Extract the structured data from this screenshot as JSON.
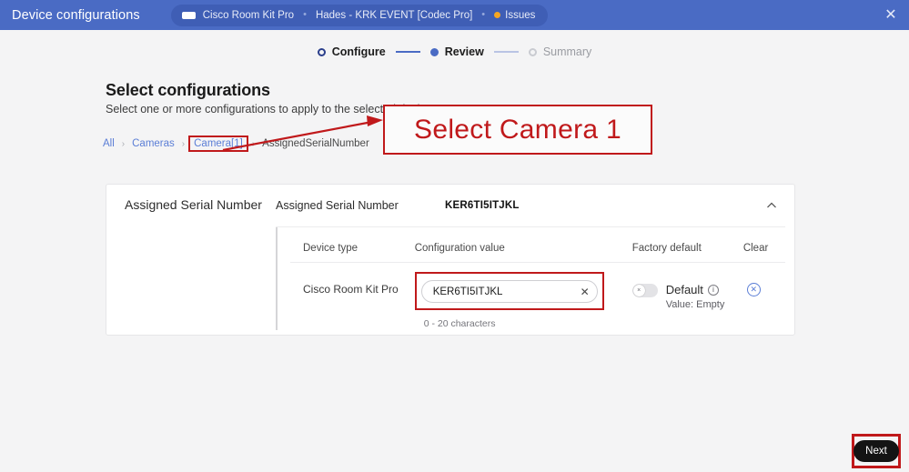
{
  "topbar": {
    "title": "Device configurations",
    "device_pill": {
      "device_icon": "codec-device-icon",
      "device_name": "Cisco Room Kit Pro",
      "separator": "•",
      "room_name": "Hades - KRK EVENT [Codec Pro]",
      "separator2": "•",
      "issues_label": "Issues",
      "issues_dot_color": "#f5a623"
    },
    "close_icon": "close-icon",
    "background_color": "#4a6bc4"
  },
  "stepper": {
    "steps": [
      {
        "label": "Configure",
        "state": "current"
      },
      {
        "label": "Review",
        "state": "filled"
      },
      {
        "label": "Summary",
        "state": "upcoming"
      }
    ],
    "accent_color": "#4a6bc4"
  },
  "page": {
    "title": "Select configurations",
    "subtitle": "Select one or more configurations to apply to the selected device."
  },
  "breadcrumb": {
    "items": [
      {
        "label": "All",
        "link": true,
        "highlighted": false
      },
      {
        "label": "Cameras",
        "link": true,
        "highlighted": false
      },
      {
        "label": "Camera[1]",
        "link": true,
        "highlighted": true
      },
      {
        "label": "AssignedSerialNumber",
        "link": false,
        "highlighted": false
      }
    ],
    "separator": "›"
  },
  "annotation": {
    "text": "Select Camera 1",
    "color": "#c0191b",
    "arrow": "annotation-arrow"
  },
  "card": {
    "group_title": "Assigned Serial Number",
    "panel": {
      "name": "Assigned Serial Number",
      "value": "KER6TI5ITJKL",
      "collapse_icon": "chevron-up-icon"
    },
    "table": {
      "headers": [
        "Device type",
        "Configuration value",
        "Factory default",
        "Clear"
      ],
      "rows": [
        {
          "device_type": "Cisco Room Kit Pro",
          "config_value": "KER6TI5ITJKL",
          "config_placeholder": "",
          "clear_input_icon": "close-icon",
          "hint": "0 - 20 characters",
          "factory_default": {
            "toggle_state": "off",
            "toggle_glyph": "×",
            "label": "Default",
            "info_icon": "info-icon",
            "value_text": "Value: Empty"
          },
          "clear_icon": "clear-circle-icon"
        }
      ]
    }
  },
  "footer": {
    "next_label": "Next",
    "next_highlighted": true
  }
}
